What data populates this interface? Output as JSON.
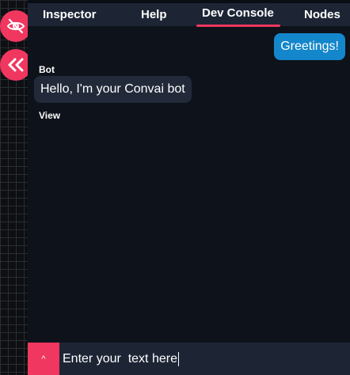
{
  "sidebar": {
    "hide_icon": "eye-slash-icon",
    "collapse_icon": "double-chevron-left-icon"
  },
  "tabs": [
    {
      "label": "Inspector"
    },
    {
      "label": "Help"
    },
    {
      "label": "Dev Console",
      "active": true
    },
    {
      "label": "Nodes"
    }
  ],
  "chat": {
    "user_message": "Greetings!",
    "bot_name": "Bot",
    "bot_message": "Hello, I'm your Convai bot",
    "view_label": "View"
  },
  "input": {
    "toggle_label": "^",
    "value": "Enter your  text here"
  },
  "colors": {
    "accent": "#f0375f",
    "user_bubble": "#1486cb",
    "bot_bubble": "#222a3a",
    "panel": "#0e121b",
    "bar": "#1d2535"
  }
}
